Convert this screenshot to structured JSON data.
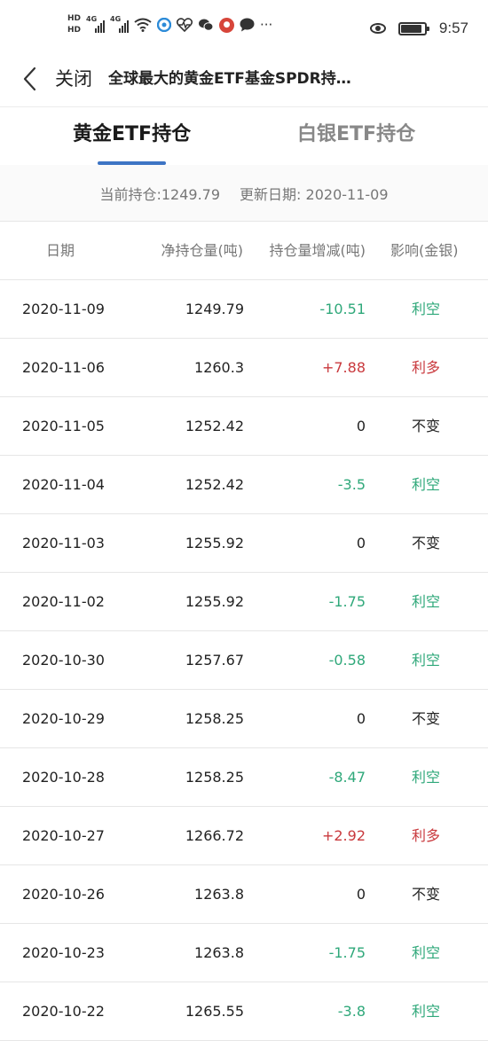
{
  "status_bar": {
    "hd1": "HD",
    "hd2": "HD",
    "net1": "4G",
    "net2": "4G",
    "more": "···",
    "time": "9:57",
    "battery_level": 0.9
  },
  "nav": {
    "close_label": "关闭",
    "title": "全球最大的黄金ETF基金SPDR持…"
  },
  "tabs": [
    {
      "label": "黄金ETF持仓",
      "active": true
    },
    {
      "label": "白银ETF持仓",
      "active": false
    }
  ],
  "summary": {
    "holdings": "当前持仓:1249.79",
    "update_date": "更新日期: 2020-11-09"
  },
  "table": {
    "headers": [
      "日期",
      "净持仓量(吨)",
      "持仓量增减(吨)",
      "影响(金银)"
    ],
    "rows": [
      {
        "date": "2020-11-09",
        "net": "1249.79",
        "change": "-10.51",
        "impact": "利空"
      },
      {
        "date": "2020-11-06",
        "net": "1260.3",
        "change": "+7.88",
        "impact": "利多"
      },
      {
        "date": "2020-11-05",
        "net": "1252.42",
        "change": "0",
        "impact": "不变"
      },
      {
        "date": "2020-11-04",
        "net": "1252.42",
        "change": "-3.5",
        "impact": "利空"
      },
      {
        "date": "2020-11-03",
        "net": "1255.92",
        "change": "0",
        "impact": "不变"
      },
      {
        "date": "2020-11-02",
        "net": "1255.92",
        "change": "-1.75",
        "impact": "利空"
      },
      {
        "date": "2020-10-30",
        "net": "1257.67",
        "change": "-0.58",
        "impact": "利空"
      },
      {
        "date": "2020-10-29",
        "net": "1258.25",
        "change": "0",
        "impact": "不变"
      },
      {
        "date": "2020-10-28",
        "net": "1258.25",
        "change": "-8.47",
        "impact": "利空"
      },
      {
        "date": "2020-10-27",
        "net": "1266.72",
        "change": "+2.92",
        "impact": "利多"
      },
      {
        "date": "2020-10-26",
        "net": "1263.8",
        "change": "0",
        "impact": "不变"
      },
      {
        "date": "2020-10-23",
        "net": "1263.8",
        "change": "-1.75",
        "impact": "利空"
      },
      {
        "date": "2020-10-22",
        "net": "1265.55",
        "change": "-3.8",
        "impact": "利空"
      }
    ]
  },
  "colors": {
    "bearish": "#2fa87a",
    "bullish": "#c9393d",
    "accent": "#3d74c4"
  }
}
